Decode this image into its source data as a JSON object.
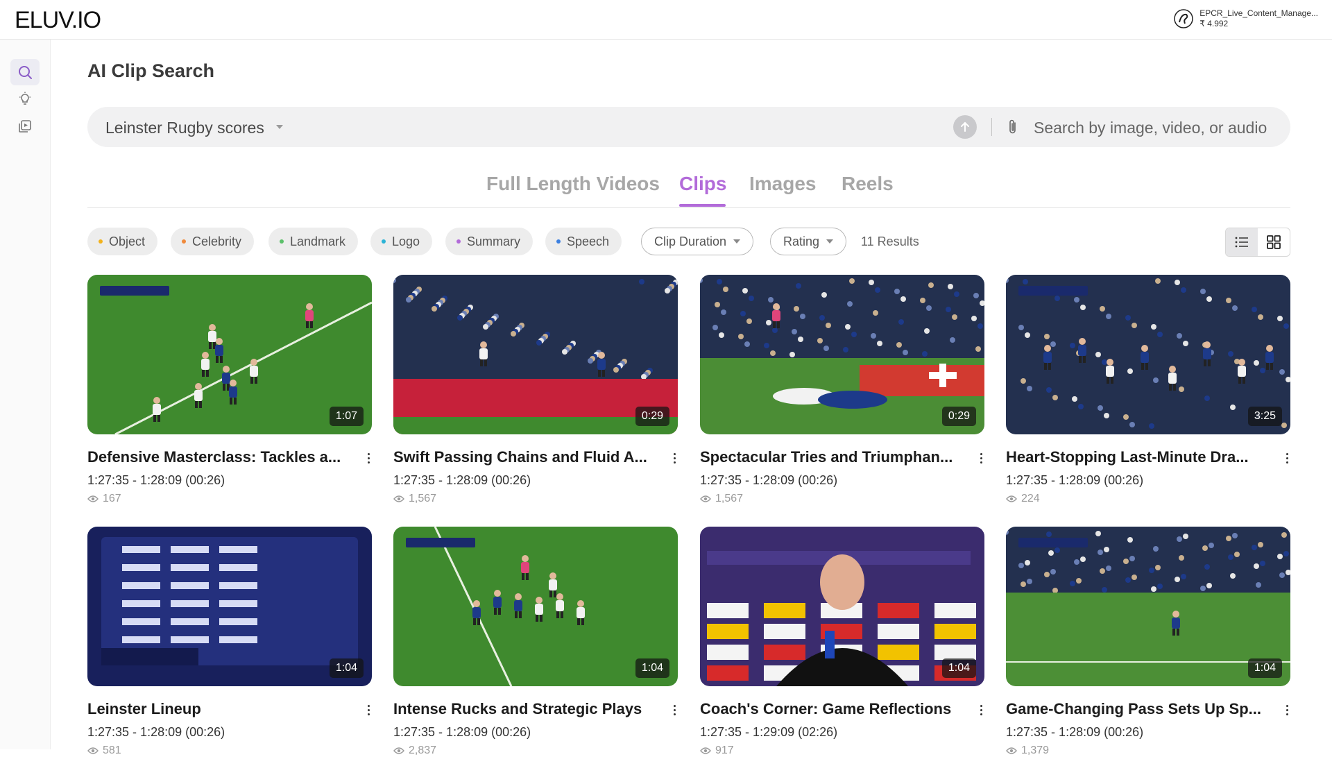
{
  "app": {
    "logo": "ELUV.IO"
  },
  "account": {
    "name": "EPCR_Live_Content_Manage...",
    "balance": "₹ 4.992"
  },
  "page": {
    "title": "AI Clip Search"
  },
  "search": {
    "value": "Leinster Rugby scores",
    "media_placeholder": "Search by image, video, or audio"
  },
  "tabs": [
    {
      "label": "Full Length Videos",
      "active": false
    },
    {
      "label": "Clips",
      "active": true
    },
    {
      "label": "Images",
      "active": false
    },
    {
      "label": "Reels",
      "active": false
    }
  ],
  "filters": {
    "chips": [
      {
        "label": "Object",
        "color": "#f2b21c"
      },
      {
        "label": "Celebrity",
        "color": "#f08a3c"
      },
      {
        "label": "Landmark",
        "color": "#5bc06a"
      },
      {
        "label": "Logo",
        "color": "#2bb3d6"
      },
      {
        "label": "Summary",
        "color": "#b26bd9"
      },
      {
        "label": "Speech",
        "color": "#3b7fe0"
      }
    ],
    "clip_duration": "Clip Duration",
    "rating": "Rating",
    "results": "11 Results"
  },
  "cards": [
    {
      "title": "Defensive Masterclass: Tackles a...",
      "time": "1:27:35 - 1:28:09 (00:26)",
      "views": "167",
      "duration": "1:07",
      "scene": "lineout"
    },
    {
      "title": "Swift Passing Chains and Fluid A...",
      "time": "1:27:35 - 1:28:09 (00:26)",
      "views": "1,567",
      "duration": "0:29",
      "scene": "run"
    },
    {
      "title": "Spectacular Tries and Triumphan...",
      "time": "1:27:35 - 1:28:09 (00:26)",
      "views": "1,567",
      "duration": "0:29",
      "scene": "try"
    },
    {
      "title": "Heart-Stopping Last-Minute Dra...",
      "time": "1:27:35 - 1:28:09 (00:26)",
      "views": "224",
      "duration": "3:25",
      "scene": "huddle"
    },
    {
      "title": "Leinster Lineup",
      "time": "1:27:35 - 1:28:09 (00:26)",
      "views": "581",
      "duration": "1:04",
      "scene": "lineup"
    },
    {
      "title": "Intense Rucks and Strategic Plays",
      "time": "1:27:35 - 1:28:09 (00:26)",
      "views": "2,837",
      "duration": "1:04",
      "scene": "ruck"
    },
    {
      "title": "Coach's Corner: Game Reflections",
      "time": "1:27:35 - 1:29:09 (02:26)",
      "views": "917",
      "duration": "1:04",
      "scene": "interview"
    },
    {
      "title": "Game-Changing Pass Sets Up Sp...",
      "time": "1:27:35 - 1:28:09 (00:26)",
      "views": "1,379",
      "duration": "1:04",
      "scene": "wide"
    }
  ],
  "icons": {
    "sidebar": [
      "search-icon",
      "lightbulb-icon",
      "media-library-icon"
    ]
  }
}
